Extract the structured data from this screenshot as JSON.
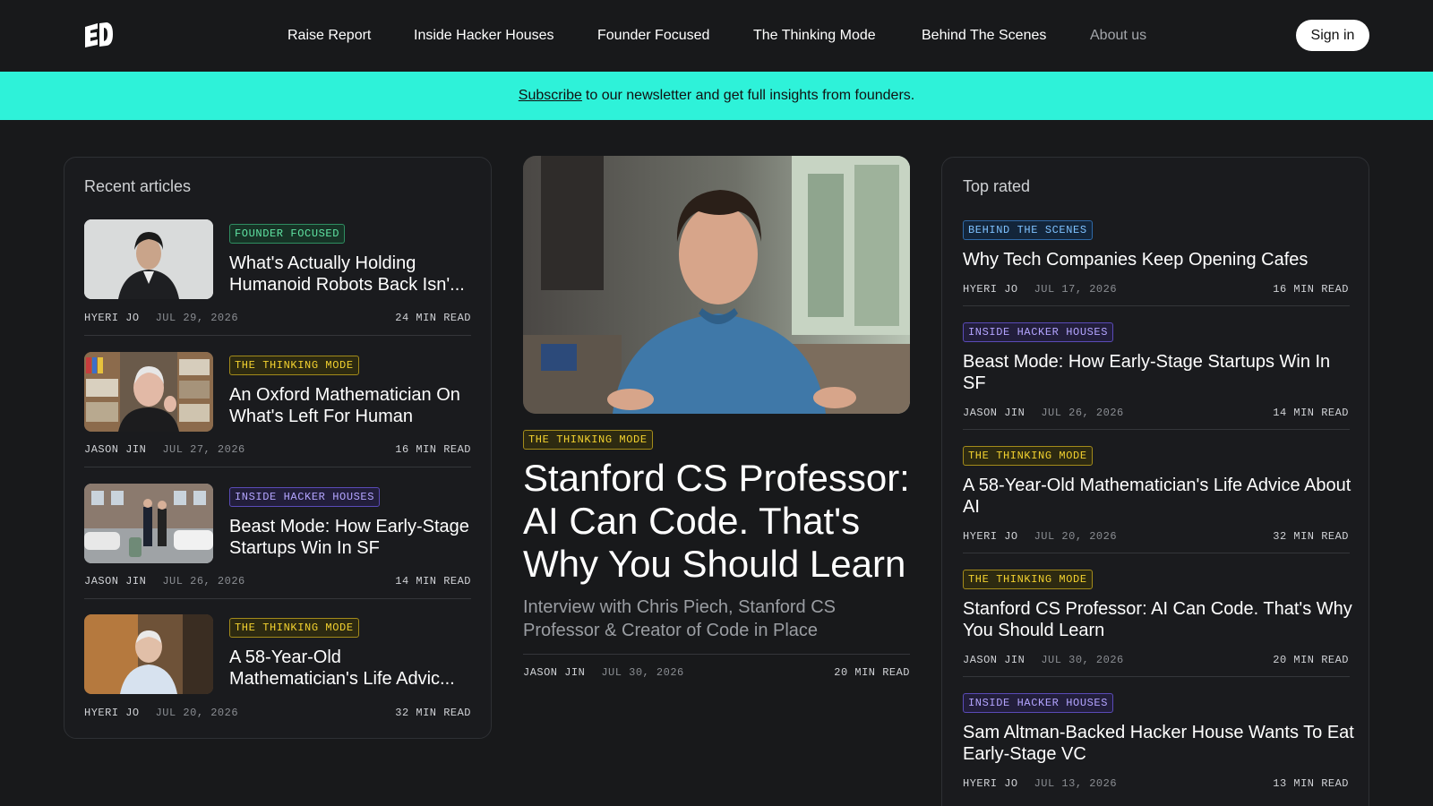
{
  "header": {
    "logo_icon": "ed-logo-icon",
    "nav": [
      "Raise Report",
      "Inside Hacker Houses",
      "Founder Focused",
      "The Thinking Mode",
      "Behind The Scenes",
      "About us"
    ],
    "sign_in": "Sign in"
  },
  "banner": {
    "link": "Subscribe",
    "text": "to our newsletter and get full insights from founders."
  },
  "recent": {
    "title": "Recent articles",
    "items": [
      {
        "tag": "FOUNDER FOCUSED",
        "title": "What's Actually Holding Humanoid Robots Back Isn'...",
        "author": "HYERI JO",
        "date": "JUL 29, 2026",
        "read": "24 MIN READ"
      },
      {
        "tag": "THE THINKING MODE",
        "title": "An Oxford Mathematician On What's Left For Human",
        "author": "JASON JIN",
        "date": "JUL 27, 2026",
        "read": "16 MIN READ"
      },
      {
        "tag": "INSIDE HACKER HOUSES",
        "title": "Beast Mode: How Early-Stage Startups Win In SF",
        "author": "JASON JIN",
        "date": "JUL 26, 2026",
        "read": "14 MIN READ"
      },
      {
        "tag": "THE THINKING MODE",
        "title": "A 58-Year-Old Mathematician's Life Advic...",
        "author": "HYERI JO",
        "date": "JUL 20, 2026",
        "read": "32 MIN READ"
      }
    ]
  },
  "feature": {
    "tag": "THE THINKING MODE",
    "title": "Stanford CS Professor: AI Can Code. That's Why You Should Learn",
    "subtitle": "Interview with Chris Piech, Stanford CS Professor & Creator of Code in Place",
    "author": "JASON JIN",
    "date": "JUL 30, 2026",
    "read": "20 MIN READ"
  },
  "top": {
    "title": "Top rated",
    "items": [
      {
        "tag": "BEHIND THE SCENES",
        "title": "Why Tech Companies Keep Opening Cafes",
        "author": "HYERI JO",
        "date": "JUL 17, 2026",
        "read": "16 MIN READ"
      },
      {
        "tag": "INSIDE HACKER HOUSES",
        "title": "Beast Mode: How Early-Stage Startups Win In SF",
        "author": "JASON JIN",
        "date": "JUL 26, 2026",
        "read": "14 MIN READ"
      },
      {
        "tag": "THE THINKING MODE",
        "title": "A 58-Year-Old Mathematician's Life Advice About AI",
        "author": "HYERI JO",
        "date": "JUL 20, 2026",
        "read": "32 MIN READ"
      },
      {
        "tag": "THE THINKING MODE",
        "title": "Stanford CS Professor: AI Can Code. That's Why You Should Learn",
        "author": "JASON JIN",
        "date": "JUL 30, 2026",
        "read": "20 MIN READ"
      },
      {
        "tag": "INSIDE HACKER HOUSES",
        "title": "Sam Altman-Backed Hacker House Wants To Eat Early-Stage VC",
        "author": "HYERI JO",
        "date": "JUL 13, 2026",
        "read": "13 MIN READ"
      }
    ]
  },
  "colors": {
    "background": "#18191b",
    "banner": "#2ef2d9",
    "tag_founder": "#5fe3a2",
    "tag_thinking": "#f2d12f",
    "tag_hacker": "#b3a4ff",
    "tag_behind": "#7ec1ff"
  }
}
